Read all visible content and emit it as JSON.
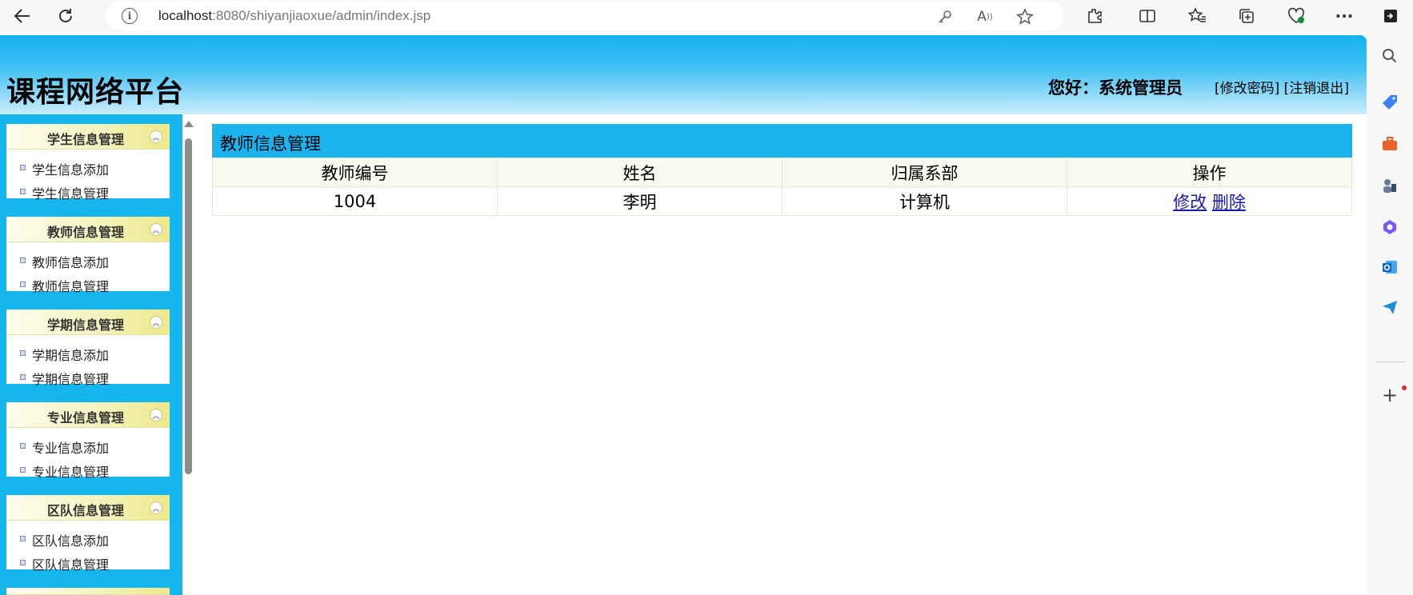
{
  "browser": {
    "url_host": "localhost",
    "url_rest": ":8080/shiyanjiaoxue/admin/index.jsp"
  },
  "header": {
    "site_title": "课程网络平台",
    "greeting": "您好：系统管理员",
    "change_password": "修改密码",
    "logout": "注销退出"
  },
  "menu": [
    {
      "title": "学生信息管理",
      "items": [
        "学生信息添加",
        "学生信息管理"
      ]
    },
    {
      "title": "教师信息管理",
      "items": [
        "教师信息添加",
        "教师信息管理"
      ]
    },
    {
      "title": "学期信息管理",
      "items": [
        "学期信息添加",
        "学期信息管理"
      ]
    },
    {
      "title": "专业信息管理",
      "items": [
        "专业信息添加",
        "专业信息管理"
      ]
    },
    {
      "title": "区队信息管理",
      "items": [
        "区队信息添加",
        "区队信息管理"
      ]
    }
  ],
  "main": {
    "panel_title": "教师信息管理",
    "columns": [
      "教师编号",
      "姓名",
      "归属系部",
      "操作"
    ],
    "rows": [
      {
        "id": "1004",
        "name": "李明",
        "dept": "计算机",
        "edit": "修改",
        "delete": "删除"
      }
    ]
  }
}
